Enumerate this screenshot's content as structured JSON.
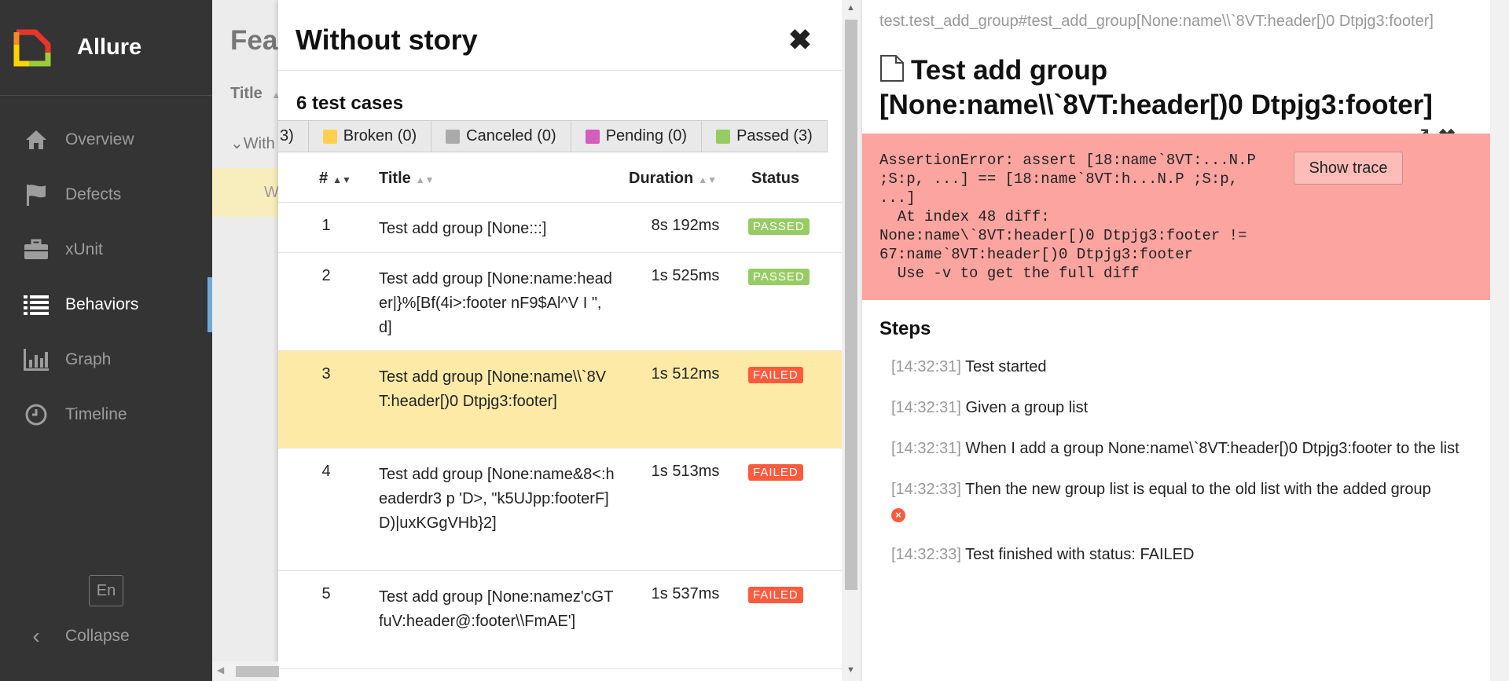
{
  "app": {
    "name": "Allure"
  },
  "sidebar": {
    "items": [
      {
        "label": "Overview",
        "icon": "home-icon"
      },
      {
        "label": "Defects",
        "icon": "flag-icon"
      },
      {
        "label": "xUnit",
        "icon": "briefcase-icon"
      },
      {
        "label": "Behaviors",
        "icon": "list-icon",
        "active": true
      },
      {
        "label": "Graph",
        "icon": "bar-chart-icon"
      },
      {
        "label": "Timeline",
        "icon": "clock-icon"
      }
    ],
    "language": "En",
    "collapse": "Collapse"
  },
  "tree": {
    "title": "Fea",
    "column": "Title",
    "group": "With",
    "selected": "W"
  },
  "mid": {
    "title": "Without story",
    "close": "✖",
    "count": "6 test cases",
    "status_filters": [
      {
        "label": "3)",
        "color": ""
      },
      {
        "label": "Broken (0)",
        "color": "#ffd050"
      },
      {
        "label": "Canceled (0)",
        "color": "#aaaaaa"
      },
      {
        "label": "Pending (0)",
        "color": "#d35ebe"
      },
      {
        "label": "Passed (3)",
        "color": "#97cc64"
      }
    ],
    "columns": {
      "num": "#",
      "title": "Title",
      "duration": "Duration",
      "status": "Status"
    },
    "rows": [
      {
        "num": "1",
        "title": "Test add group [None:::]",
        "duration": "8s 192ms",
        "status": "PASSED"
      },
      {
        "num": "2",
        "title": "Test add group [None:name:header|}%[Bf(4i>:footer nF9$Al^V I \",d]",
        "duration": "1s 525ms",
        "status": "PASSED"
      },
      {
        "num": "3",
        "title": "Test add group [None:name\\\\`8VT:header[)0 Dtpjg3:footer]",
        "duration": "1s 512ms",
        "status": "FAILED",
        "selected": true
      },
      {
        "num": "4",
        "title": "Test add group [None:name&8<:headerdr3 p 'D>, \"k5UJpp:footerF]D)|uxKGgVHb}2]",
        "duration": "1s 513ms",
        "status": "FAILED"
      },
      {
        "num": "5",
        "title": "Test add group [None:namez'cGTfuV:header@:footer\\\\FmAE']",
        "duration": "1s 537ms",
        "status": "FAILED"
      }
    ]
  },
  "detail": {
    "breadcrumb": "test.test_add_group#test_add_group[None:name\\\\`8VT:header[)0 Dtpjg3:footer]",
    "title": "Test add group [None:name\\\\`8VT:header[)0 Dtpjg3:footer]",
    "error": "AssertionError: assert [18:name`8VT:...N.P\n;S:p, ...] == [18:name`8VT:h...N.P ;S:p,\n...]\n  At index 48 diff:\nNone:name\\`8VT:header[)0 Dtpjg3:footer !=\n67:name`8VT:header[)0 Dtpjg3:footer\n  Use -v to get the full diff",
    "show_trace": "Show trace",
    "steps_heading": "Steps",
    "steps": [
      {
        "time": "[14:32:31]",
        "text": "Test started"
      },
      {
        "time": "[14:32:31]",
        "text": "Given a group list"
      },
      {
        "time": "[14:32:31]",
        "text": "When I add a group None:name\\`8VT:header[)0 Dtpjg3:footer to the list"
      },
      {
        "time": "[14:32:33]",
        "text": "Then the new group list is equal to the old list with the added group",
        "failed": true
      },
      {
        "time": "[14:32:33]",
        "text": "Test finished with status: FAILED"
      }
    ]
  },
  "colors": {
    "sidebar_bg": "#343434",
    "active_indicator": "#6fa9d6",
    "passed": "#97cc64",
    "failed": "#fd5a3e",
    "error_bg": "#fca5a0",
    "selected_row": "#fdeaa7"
  }
}
